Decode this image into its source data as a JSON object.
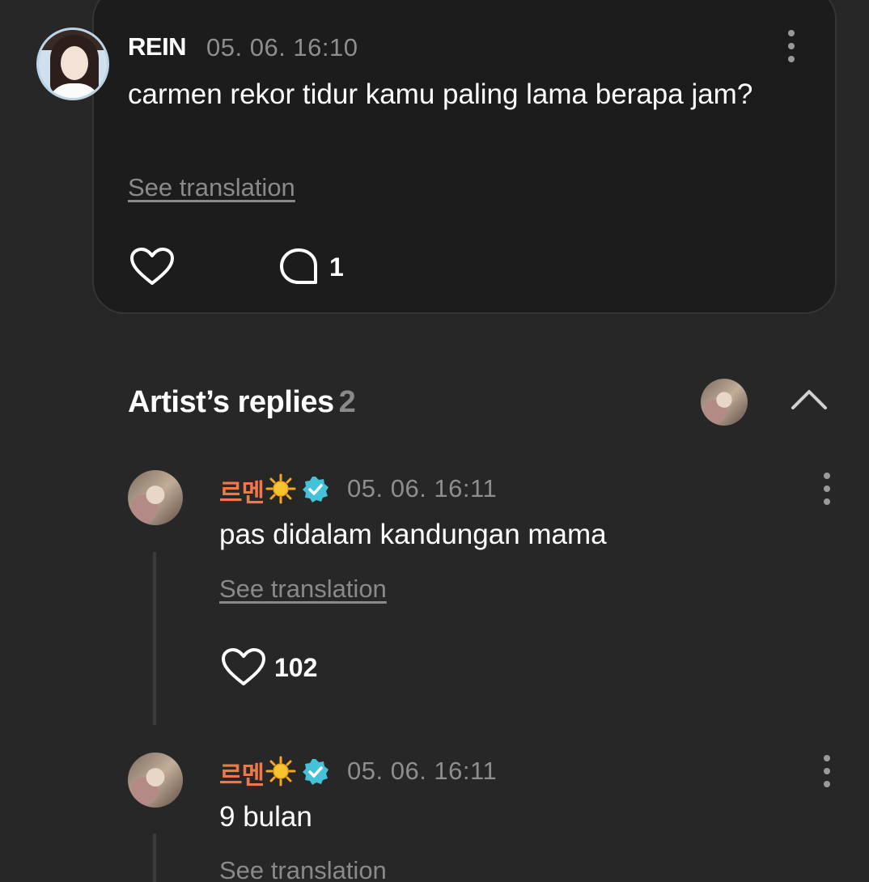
{
  "comment": {
    "author": "REIN",
    "timestamp": "05. 06. 16:10",
    "text": "carmen rekor tidur kamu paling lama berapa jam?",
    "translate_label": "See translation",
    "reply_count": "1"
  },
  "artist_replies": {
    "title": "Artist’s replies",
    "count": "2",
    "items": [
      {
        "author": "르멘",
        "timestamp": "05. 06. 16:11",
        "text": "pas didalam kandungan mama",
        "translate_label": "See translation",
        "like_count": "102"
      },
      {
        "author": "르멘",
        "timestamp": "05. 06. 16:11",
        "text": "9 bulan",
        "translate_label": "See translation"
      }
    ]
  },
  "icons": {
    "more": "more-vertical-icon",
    "like": "heart-icon",
    "reply": "chat-bubble-icon",
    "collapse": "chevron-up-icon",
    "verified": "verified-badge-icon",
    "emoji": "sun-emoji-icon"
  },
  "colors": {
    "background": "#272727",
    "card": "#1c1c1c",
    "artist_name": "#f0774a",
    "verified": "#45c2d8",
    "muted": "#8e8e8e"
  }
}
